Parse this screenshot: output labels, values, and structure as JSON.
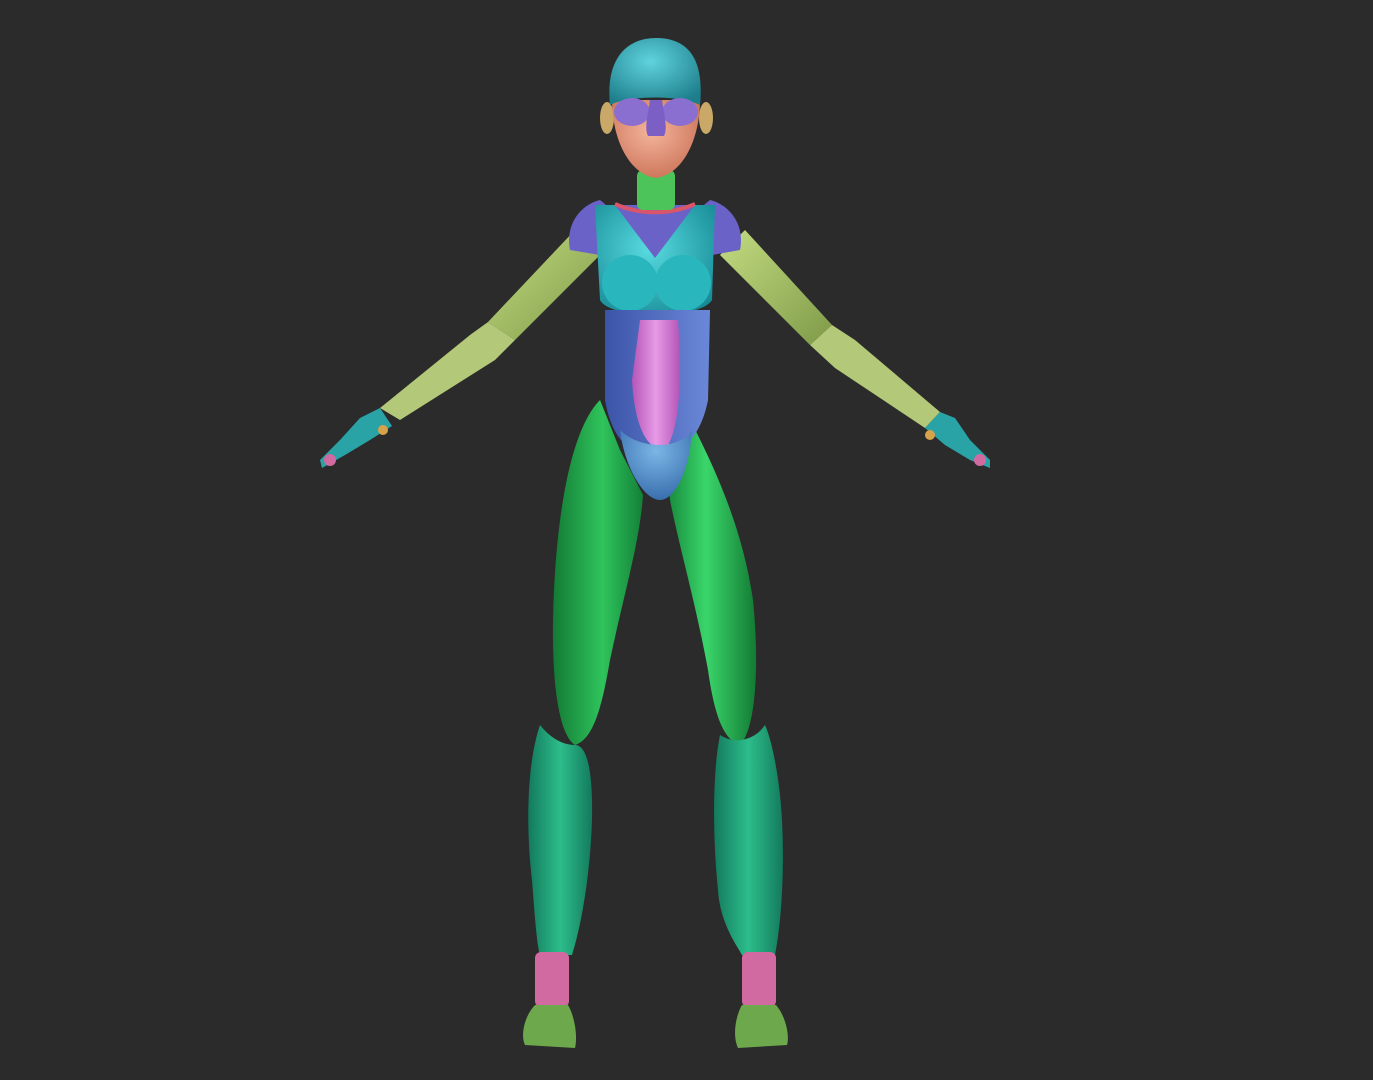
{
  "scene": {
    "background_color": "#2b2b2b",
    "subject": "character-base-mesh",
    "pose": "A-pose",
    "view": "front"
  },
  "palette": {
    "head_cap": "#2fa8b4",
    "skin": "#e8967a",
    "eye_mask": "#8a6fd0",
    "neck": "#4cc45a",
    "chest": "#2ab6bd",
    "shoulder": "#6b62c8",
    "collar_strap": "#d9556a",
    "abdomen_side": "#5a74c8",
    "abdomen_center": "#d07ad0",
    "pelvis": "#4b8ec8",
    "upper_arm": "#a9c66a",
    "forearm": "#b6cc7a",
    "hand": "#2aa3a6",
    "thigh": "#21a849",
    "shin": "#1fa47a",
    "ankle": "#d06aa0",
    "foot": "#6da84c"
  }
}
